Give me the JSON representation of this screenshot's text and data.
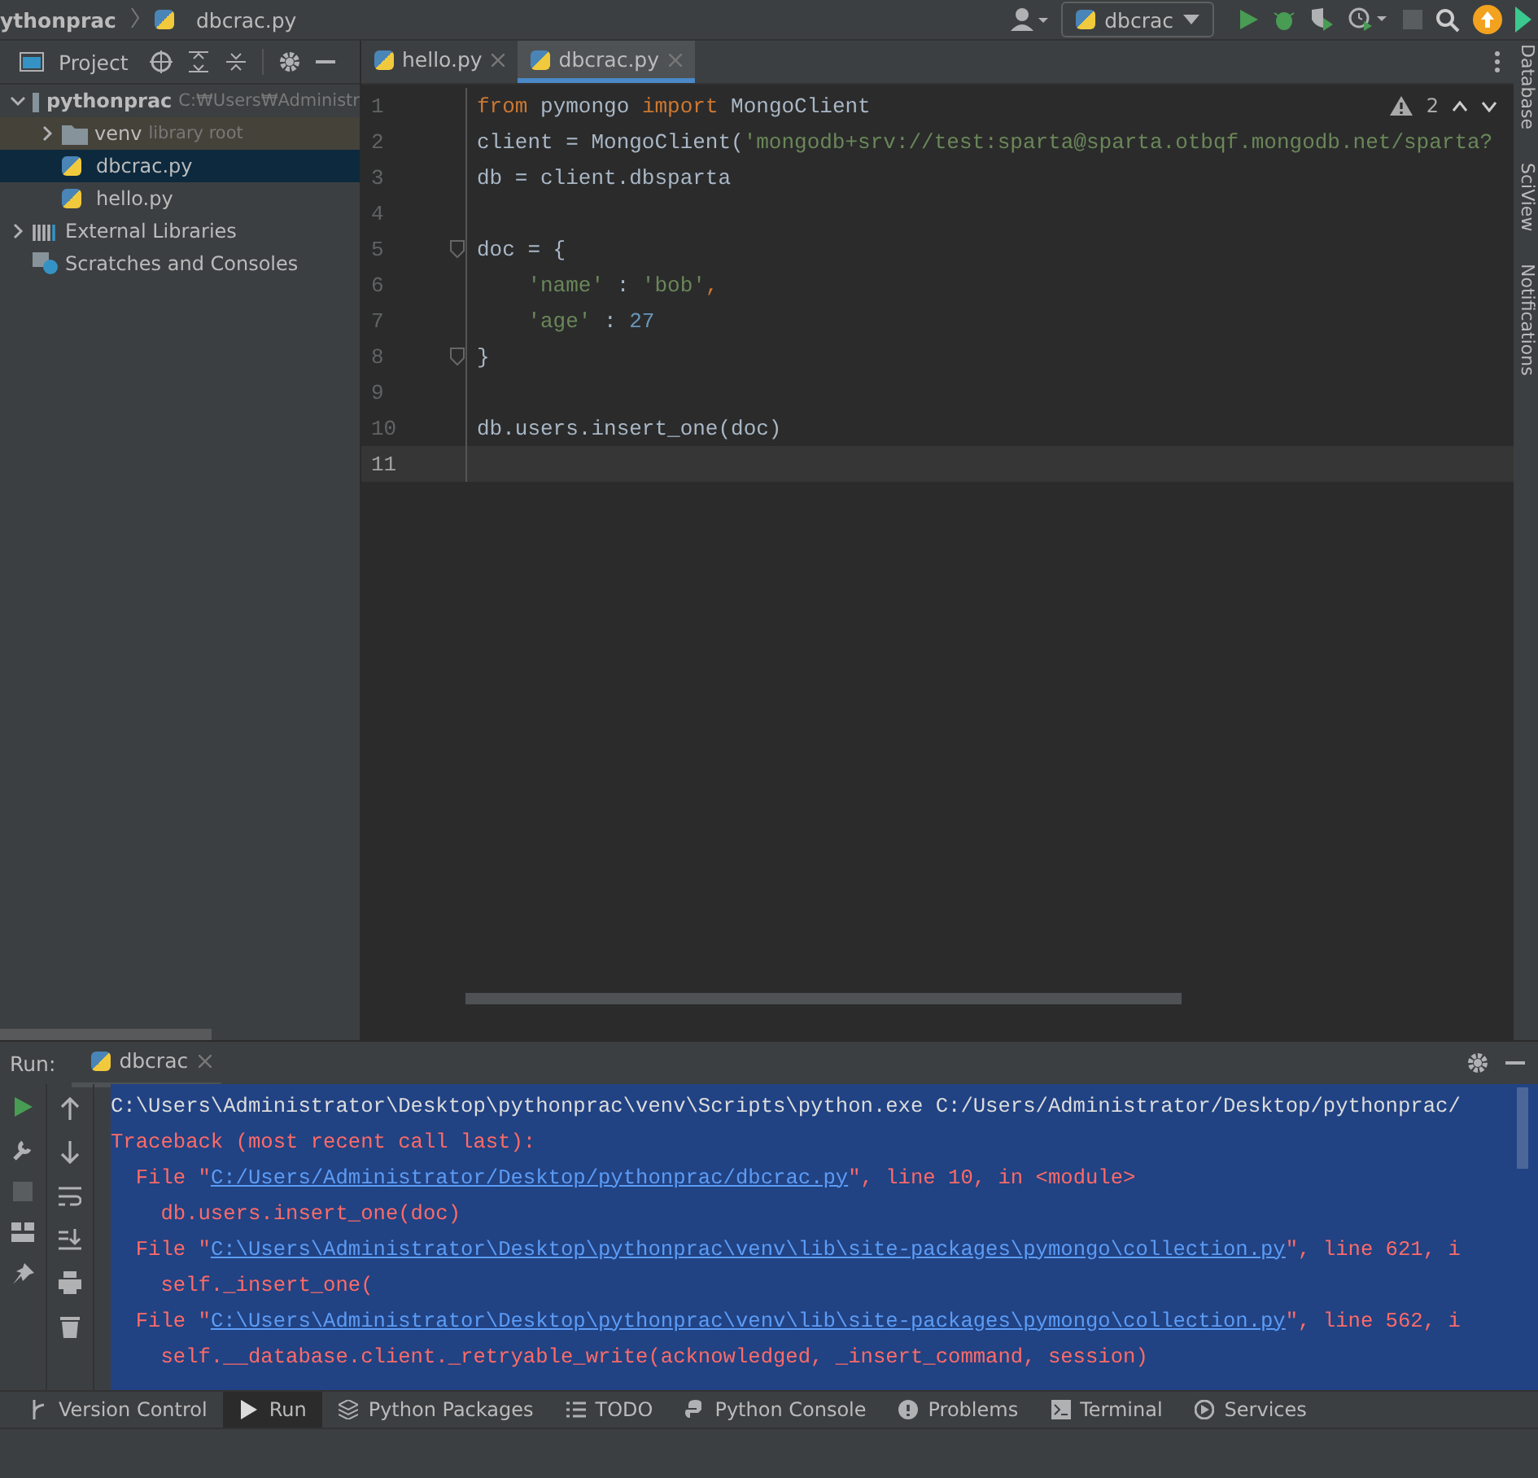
{
  "navbar": {
    "breadcrumbs": [
      {
        "label": "ythonprac",
        "kind": "folder"
      },
      {
        "label": "dbcrac.py",
        "kind": "file"
      }
    ],
    "run_config": "dbcrac"
  },
  "project_panel": {
    "title": "Project",
    "tree": [
      {
        "label": "pythonprac",
        "hint": "C:₩Users₩Administr",
        "kind": "folder",
        "expanded": true,
        "selected": false,
        "children": [
          {
            "label": "venv",
            "hint": "library root",
            "kind": "folder",
            "expanded": false,
            "selected": false
          },
          {
            "label": "dbcrac.py",
            "kind": "python",
            "selected": true
          },
          {
            "label": "hello.py",
            "kind": "python",
            "selected": false
          }
        ]
      },
      {
        "label": "External Libraries",
        "kind": "libraries",
        "expanded": false,
        "selected": false
      },
      {
        "label": "Scratches and Consoles",
        "kind": "scratches",
        "selected": false
      }
    ]
  },
  "tabs": [
    {
      "label": "hello.py",
      "selected": false
    },
    {
      "label": "dbcrac.py",
      "selected": true
    }
  ],
  "editor": {
    "warnings": "2",
    "lines": [
      {
        "number": "1",
        "current": false,
        "tokens": [
          {
            "text": "from ",
            "kind": "keyword"
          },
          {
            "text": "pymongo ",
            "kind": "plain"
          },
          {
            "text": "import ",
            "kind": "keyword"
          },
          {
            "text": "MongoClient",
            "kind": "plain"
          }
        ]
      },
      {
        "number": "2",
        "current": false,
        "tokens": [
          {
            "text": "client = MongoClient(",
            "kind": "plain"
          },
          {
            "text": "'mongodb+srv://test:sparta@sparta.otbqf.mongodb.net/sparta?",
            "kind": "string"
          }
        ]
      },
      {
        "number": "3",
        "current": false,
        "tokens": [
          {
            "text": "db = client.dbsparta",
            "kind": "plain"
          }
        ]
      },
      {
        "number": "4",
        "current": false
      },
      {
        "number": "5",
        "current": false,
        "fold": true,
        "tokens": [
          {
            "text": "doc = {",
            "kind": "plain"
          }
        ]
      },
      {
        "number": "6",
        "current": false,
        "tokens": [
          {
            "text": "    'name'",
            "kind": "string"
          },
          {
            "text": " : ",
            "kind": "plain"
          },
          {
            "text": "'bob'",
            "kind": "string"
          },
          {
            "text": ",",
            "kind": "keyword"
          }
        ]
      },
      {
        "number": "7",
        "current": false,
        "tokens": [
          {
            "text": "    'age'",
            "kind": "string"
          },
          {
            "text": " : ",
            "kind": "plain"
          },
          {
            "text": "27",
            "kind": "number"
          }
        ]
      },
      {
        "number": "8",
        "current": false,
        "fold": true,
        "tokens": [
          {
            "text": "}",
            "kind": "plain"
          }
        ]
      },
      {
        "number": "9",
        "current": false
      },
      {
        "number": "10",
        "current": false,
        "tokens": [
          {
            "text": "db.users.insert_one(doc)",
            "kind": "plain"
          }
        ]
      },
      {
        "number": "11",
        "current": true
      }
    ]
  },
  "right_stripe": [
    "Database",
    "SciView",
    "Notifications"
  ],
  "run_panel": {
    "label": "Run:",
    "tab": "dbcrac",
    "console": [
      [
        {
          "text": "C:\\Users\\Administrator\\Desktop\\pythonprac\\venv\\Scripts\\python.exe C:/Users/Administrator/Desktop/pythonprac/",
          "kind": "plain"
        }
      ],
      [
        {
          "text": "Traceback (most recent call last):",
          "kind": "error"
        }
      ],
      [
        {
          "text": "  File \"",
          "kind": "error"
        },
        {
          "text": "C:/Users/Administrator/Desktop/pythonprac/dbcrac.py",
          "kind": "link"
        },
        {
          "text": "\", line 10, in <module>",
          "kind": "error"
        }
      ],
      [
        {
          "text": "    db.users.insert_one(doc)",
          "kind": "error"
        }
      ],
      [
        {
          "text": "  File \"",
          "kind": "error"
        },
        {
          "text": "C:\\Users\\Administrator\\Desktop\\pythonprac\\venv\\lib\\site-packages\\pymongo\\collection.py",
          "kind": "link"
        },
        {
          "text": "\", line 621, i",
          "kind": "error"
        }
      ],
      [
        {
          "text": "    self._insert_one(",
          "kind": "error"
        }
      ],
      [
        {
          "text": "  File \"",
          "kind": "error"
        },
        {
          "text": "C:\\Users\\Administrator\\Desktop\\pythonprac\\venv\\lib\\site-packages\\pymongo\\collection.py",
          "kind": "link"
        },
        {
          "text": "\", line 562, i",
          "kind": "error"
        }
      ],
      [
        {
          "text": "    self.__database.client._retryable_write(acknowledged, _insert_command, session)",
          "kind": "error"
        }
      ]
    ]
  },
  "tool_tabs": [
    {
      "label": "Version Control",
      "kind": "vcs",
      "selected": false
    },
    {
      "label": "Run",
      "kind": "run",
      "selected": true
    },
    {
      "label": "Python Packages",
      "kind": "packages",
      "selected": false
    },
    {
      "label": "TODO",
      "kind": "todo",
      "selected": false
    },
    {
      "label": "Python Console",
      "kind": "console",
      "selected": false
    },
    {
      "label": "Problems",
      "kind": "problems",
      "selected": false
    },
    {
      "label": "Terminal",
      "kind": "terminal",
      "selected": false
    },
    {
      "label": "Services",
      "kind": "services",
      "selected": false
    }
  ]
}
